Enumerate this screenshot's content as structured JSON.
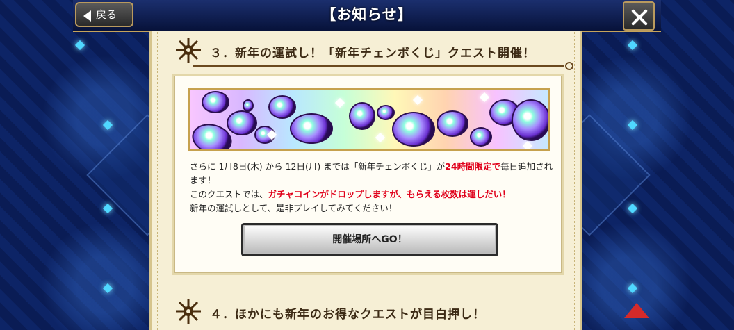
{
  "header": {
    "title": "【お知らせ】",
    "back_label": "戻る"
  },
  "sections": [
    {
      "heading": "３．新年の運試し！「新年チェンボくじ」クエスト開催！",
      "description": {
        "line1_part1": "さらに 1月8日(木) から 12日(月) までは「新年チェンボくじ」が",
        "line1_red": "24時間限定で",
        "line1_part2": "毎日追加されます！",
        "line2_part1": "このクエストでは、",
        "line2_red": "ガチャコインがドロップしますが、もらえる枚数は運しだい！",
        "line3": "新年の運試しとして、是非プレイしてみてください！"
      },
      "button_label": "開催場所へGO！"
    },
    {
      "heading": "４．ほかにも新年のお得なクエストが目白押し！"
    }
  ],
  "icons": {
    "back": "left-arrow-icon",
    "close": "close-icon",
    "section": "snowflake-ornament-icon",
    "scroll_up": "up-arrow-icon"
  },
  "colors": {
    "accent_red": "#e0001a",
    "parchment": "#f6efd5",
    "header_bg": "#0b1d58"
  }
}
